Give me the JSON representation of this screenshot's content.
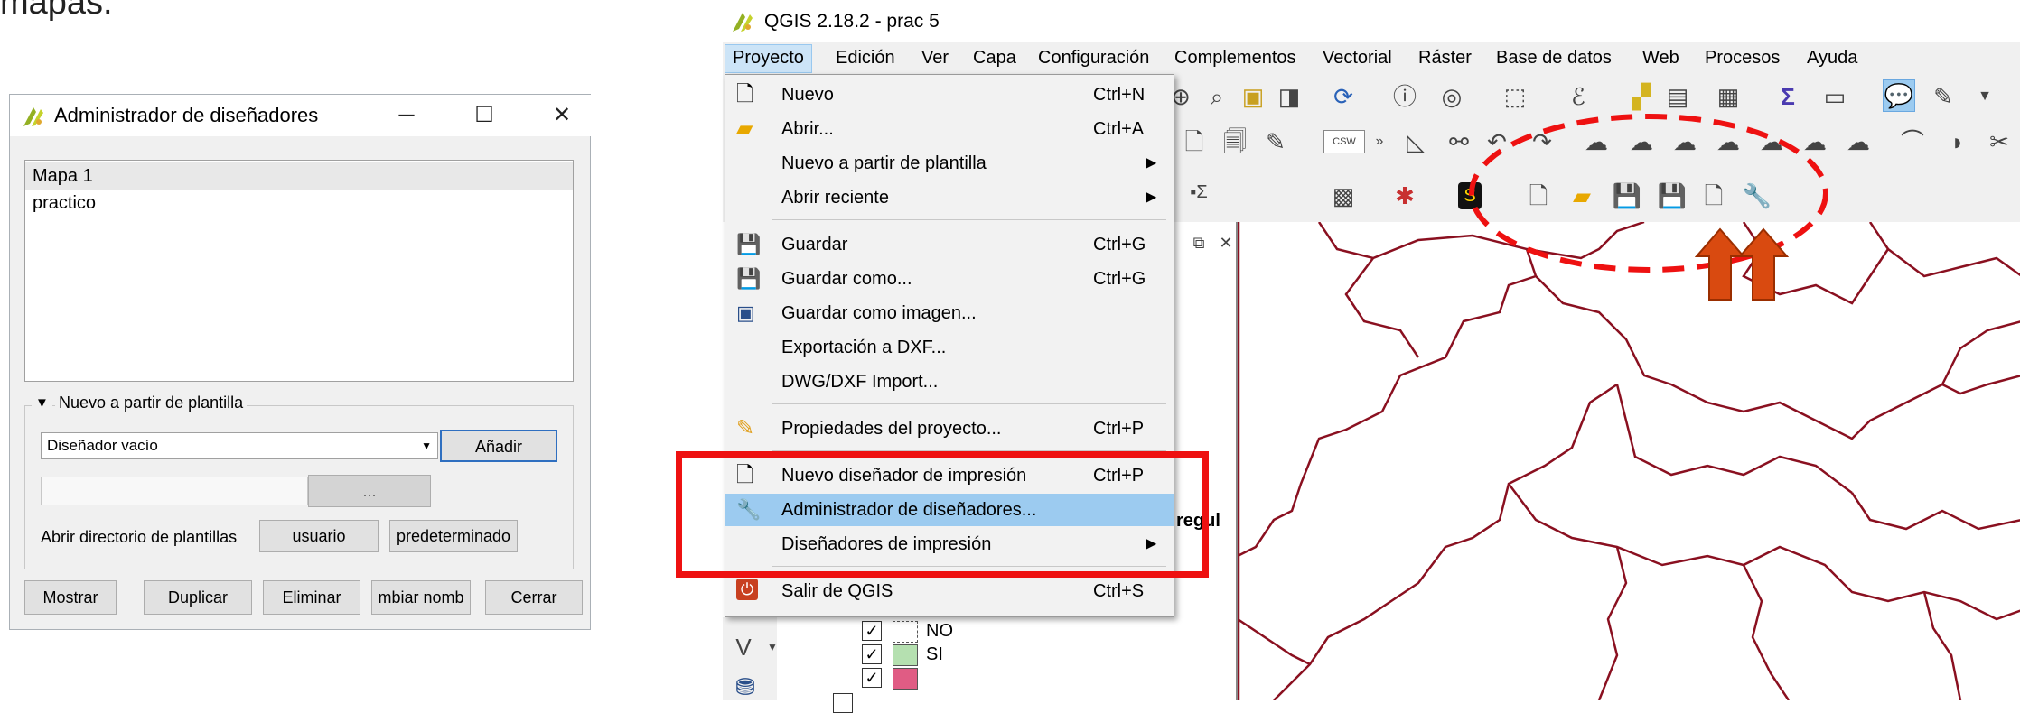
{
  "caption_fragment": "mapas.",
  "dialog": {
    "title": "Administrador de diseñadores",
    "list_items": [
      "Mapa 1",
      "practico"
    ],
    "group_label": "Nuevo a partir de plantilla",
    "template_select": "Diseñador vacío",
    "add_button": "Añadir",
    "browse_button": "...",
    "open_dir_label": "Abrir directorio de plantillas",
    "user_button": "usuario",
    "default_button": "predeterminado",
    "buttons": {
      "show": "Mostrar",
      "duplicate": "Duplicar",
      "delete": "Eliminar",
      "rename": "mbiar nomb",
      "close": "Cerrar"
    }
  },
  "qgis": {
    "title": "QGIS 2.18.2 - prac 5",
    "menubar": [
      "Proyecto",
      "Edición",
      "Ver",
      "Capa",
      "Configuración",
      "Complementos",
      "Vectorial",
      "Ráster",
      "Base de datos",
      "Web",
      "Procesos",
      "Ayuda"
    ],
    "menu": {
      "items": [
        {
          "label": "Nuevo",
          "shortcut": "Ctrl+N"
        },
        {
          "label": "Abrir...",
          "shortcut": "Ctrl+A"
        },
        {
          "label": "Nuevo a partir de plantilla",
          "shortcut": "",
          "submenu": true
        },
        {
          "label": "Abrir reciente",
          "shortcut": "",
          "submenu": true
        },
        {
          "label": "Guardar",
          "shortcut": "Ctrl+G"
        },
        {
          "label": "Guardar como...",
          "shortcut": "Ctrl+G"
        },
        {
          "label": "Guardar como imagen...",
          "shortcut": ""
        },
        {
          "label": "Exportación a DXF...",
          "shortcut": ""
        },
        {
          "label": "DWG/DXF Import...",
          "shortcut": ""
        },
        {
          "label": "Propiedades del proyecto...",
          "shortcut": "Ctrl+P"
        },
        {
          "label": "Nuevo diseñador de impresión",
          "shortcut": "Ctrl+P"
        },
        {
          "label": "Administrador de diseñadores...",
          "shortcut": ""
        },
        {
          "label": "Diseñadores de impresión",
          "shortcut": "",
          "submenu": true
        },
        {
          "label": "Salir de QGIS",
          "shortcut": "Ctrl+S"
        }
      ],
      "highlighted_index": 11
    },
    "layer_panel": {
      "partial_label": "regul",
      "legend": [
        {
          "label": "NO",
          "color": "#ffffff"
        },
        {
          "label": "SI",
          "color": "#b5e0b0"
        },
        {
          "label": "",
          "color": "#e05c84"
        }
      ]
    },
    "annotation_colors": {
      "red": "#ee1111",
      "arrow": "#d94a10"
    }
  }
}
